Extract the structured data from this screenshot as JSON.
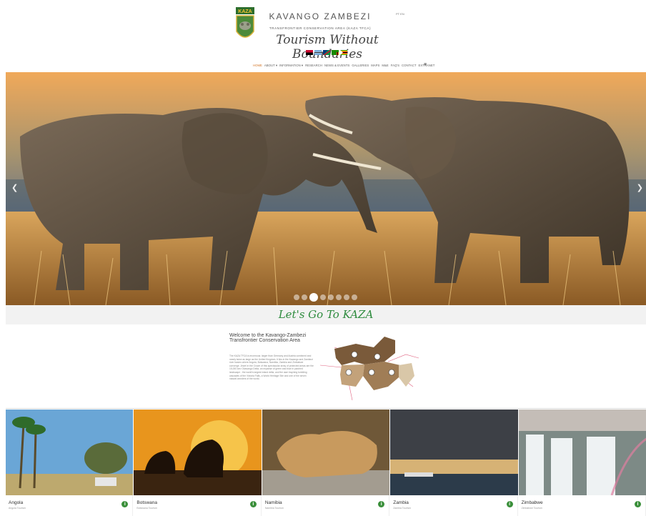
{
  "header": {
    "site_title": "KAVANGO ZAMBEZI",
    "subtitle": "TRANSFRONTIER CONSERVATION AREA (KAZA TFCA)",
    "tagline": "Tourism Without Boundaries",
    "lang": "PT EN",
    "logo_text": "KAZA",
    "flags": [
      {
        "name": "angola-flag"
      },
      {
        "name": "botswana-flag"
      },
      {
        "name": "namibia-flag"
      },
      {
        "name": "zambia-flag"
      },
      {
        "name": "zimbabwe-flag"
      }
    ]
  },
  "nav": {
    "items": [
      "HOME",
      "ABOUT ▾",
      "INFORMATION ▾",
      "RESEARCH",
      "NEWS & EVENTS",
      "GALLERIES",
      "MAPS",
      "M&E",
      "FAQ'S",
      "CONTACT",
      "EXTRANET"
    ],
    "active_index": 0,
    "menu_icon": "hamburger-icon"
  },
  "hero": {
    "prev_icon": "chevron-left-icon",
    "next_icon": "chevron-right-icon",
    "dots": 8,
    "active_dot": 2
  },
  "banner": {
    "text": "Let's Go To KAZA"
  },
  "welcome": {
    "title": "Welcome to the Kavango-Zambezi Transfrontier Conservation Area",
    "body": "The KAZA TFCA is enormous: larger than Germany and Austria combined and nearly twice as large as the United Kingdom. It lies in the Kavango and Zambezi river basins where Angola, Botswana, Namibia, Zambia and Zimbabwe converge. Jewel in the Crown of this spectacular array of protected areas are the 15,000 km² Okavango Delta, an expanse of green and blue in parched landscape - the world's largest inland delta, and the awe inspiring tumbling cascades of the Victoria Falls, a World Heritage Site and one of the seven natural wonders of the world."
  },
  "countries": [
    {
      "name": "Angola",
      "sub": "Angola Tourism"
    },
    {
      "name": "Botswana",
      "sub": "Botswana Tourism"
    },
    {
      "name": "Namibia",
      "sub": "Namibia Tourism"
    },
    {
      "name": "Zambia",
      "sub": "Zambia Tourism"
    },
    {
      "name": "Zimbabwe",
      "sub": "Zimbabwe Tourism"
    }
  ],
  "colors": {
    "accent": "#d4782b",
    "green": "#3a8f3a",
    "banner_text": "#2e8b3e"
  }
}
